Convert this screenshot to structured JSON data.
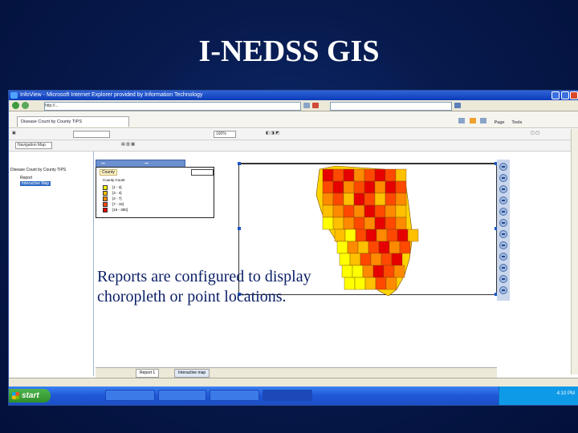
{
  "slide": {
    "title": "I-NEDSS GIS",
    "caption_line1": "Reports are configured to display",
    "caption_line2": "choropleth or point locations."
  },
  "window": {
    "title": "InfoView - Microsoft Internet Explorer provided by Information Technology"
  },
  "browser": {
    "address": "http://...",
    "tab_label": "Disease Count by County TIPS",
    "page_button": "Page",
    "tools_button": "Tools"
  },
  "app": {
    "document_title": "Disease Count by County TIPS",
    "navigator_label": "Navigation Map",
    "zoom_value": "100%",
    "tree_root": "Disease Count by County TIPS",
    "tree_child1": "Report",
    "tree_child2": "Interactive Map"
  },
  "legend": {
    "header": "County",
    "title": "County Count",
    "items": [
      {
        "label": "[1 - 3]",
        "color": "#ffff00"
      },
      {
        "label": "[3 - 4]",
        "color": "#ffc000"
      },
      {
        "label": "[4 - 7]",
        "color": "#ff8a00"
      },
      {
        "label": "[7 - 15]",
        "color": "#ff4800"
      },
      {
        "label": "[15 - 380]",
        "color": "#e60000"
      }
    ]
  },
  "bottom_tabs": {
    "tab1": "Report 1",
    "tab2": "Interactive map"
  },
  "taskbar": {
    "start_label": "start",
    "clock": "4:10 PM"
  },
  "colors": {
    "slide_bg": "#071a4d",
    "title_text": "#ffffff",
    "caption_text": "#0b1f66"
  }
}
